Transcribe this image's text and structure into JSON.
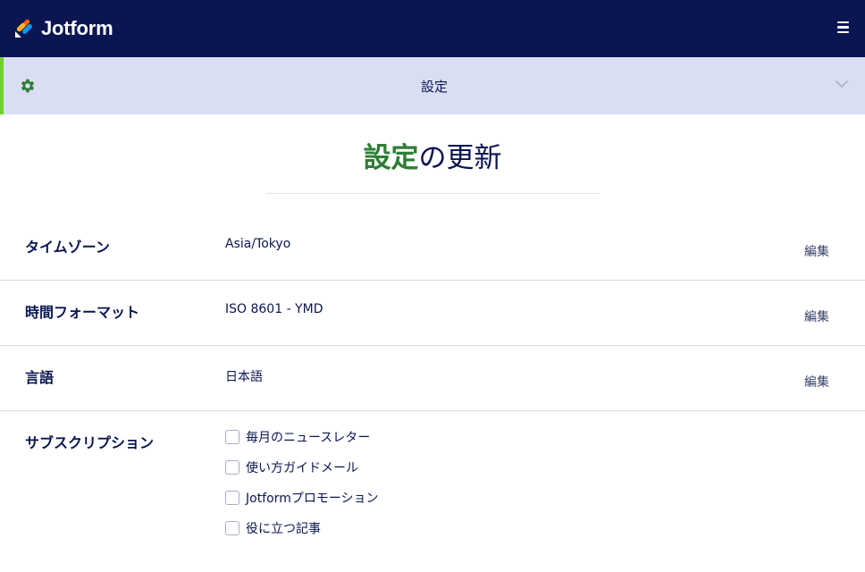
{
  "header": {
    "logo_text": "Jotform",
    "menu_icon": "hamburger-menu-icon"
  },
  "settings_bar": {
    "title": "設定",
    "icon": "gear-icon",
    "accent_color": "#6fd22e"
  },
  "page": {
    "title_highlight": "設定",
    "title_rest": "の更新",
    "highlight_color": "#2f7d36"
  },
  "rows": [
    {
      "label": "タイムゾーン",
      "value": "Asia/Tokyo",
      "edit": "編集"
    },
    {
      "label": "時間フォーマット",
      "value": "ISO 8601 - YMD",
      "edit": "編集"
    },
    {
      "label": "言語",
      "value": "日本語",
      "edit": "編集"
    }
  ],
  "subscriptions": {
    "label": "サブスクリプション",
    "items": [
      {
        "label": "毎月のニュースレター",
        "checked": false
      },
      {
        "label": "使い方ガイドメール",
        "checked": false
      },
      {
        "label": "Jotformプロモーション",
        "checked": false
      },
      {
        "label": "役に立つ記事",
        "checked": false
      }
    ]
  },
  "colors": {
    "header_bg": "#0a1551",
    "settings_bar_bg": "#dadef3",
    "text": "#0a1551"
  }
}
